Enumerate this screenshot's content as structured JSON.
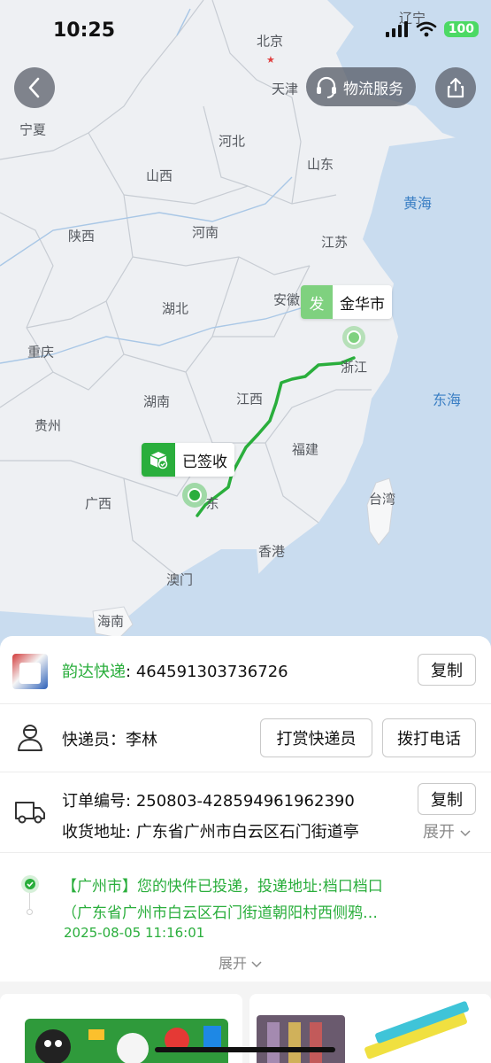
{
  "status_bar": {
    "time": "10:25",
    "battery": "100"
  },
  "map": {
    "places": {
      "liaoning": "辽宁",
      "beijing": "北京",
      "tianjin": "天津",
      "ningxia": "宁夏",
      "hebei": "河北",
      "shanxi": "山西",
      "shandong": "山东",
      "shaanxi": "陕西",
      "henan": "河南",
      "jiangsu": "江苏",
      "anhui": "安徽",
      "hubei": "湖北",
      "chongqing": "重庆",
      "zhejiang": "浙江",
      "jiangxi": "江西",
      "hunan": "湖南",
      "guizhou": "贵州",
      "fujian": "福建",
      "guangxi": "广西",
      "taiwan": "台湾",
      "hongkong": "香港",
      "macau": "澳门",
      "hainan": "海南",
      "guangdong_partial": "东"
    },
    "seas": {
      "yellow_sea": "黄海",
      "east_sea": "东海"
    },
    "logistics_service_label": "物流服务",
    "origin": {
      "badge": "发",
      "city": "金华市"
    },
    "destination": {
      "label": "已签收"
    }
  },
  "shipment": {
    "courier_company": "韵达快递",
    "colon": ":",
    "tracking_number": "464591303736726",
    "copy_label": "复制"
  },
  "courier": {
    "label": "快递员：李林",
    "tip_button": "打赏快递员",
    "call_button": "拨打电话"
  },
  "order": {
    "order_label": "订单编号:",
    "order_number": "250803-428594961962390",
    "copy_label": "复制",
    "address_label": "收货地址:",
    "address": "广东省广州市白云区石门街道亭",
    "expand_label": "展开"
  },
  "tracking": {
    "latest_line1": "【广州市】您的快件已投递，投递地址:档口档口",
    "latest_line2": "（广东省广州市白云区石门街道朝阳村西侧鸦…",
    "latest_time": "2025-08-05 11:16:01",
    "expand_label": "展开"
  },
  "colors": {
    "accent_green": "#2aae3c",
    "origin_green": "#7fd17f",
    "sea_blue": "#3b7fc4",
    "water": "#c9dcef",
    "land": "#eef0f3"
  }
}
